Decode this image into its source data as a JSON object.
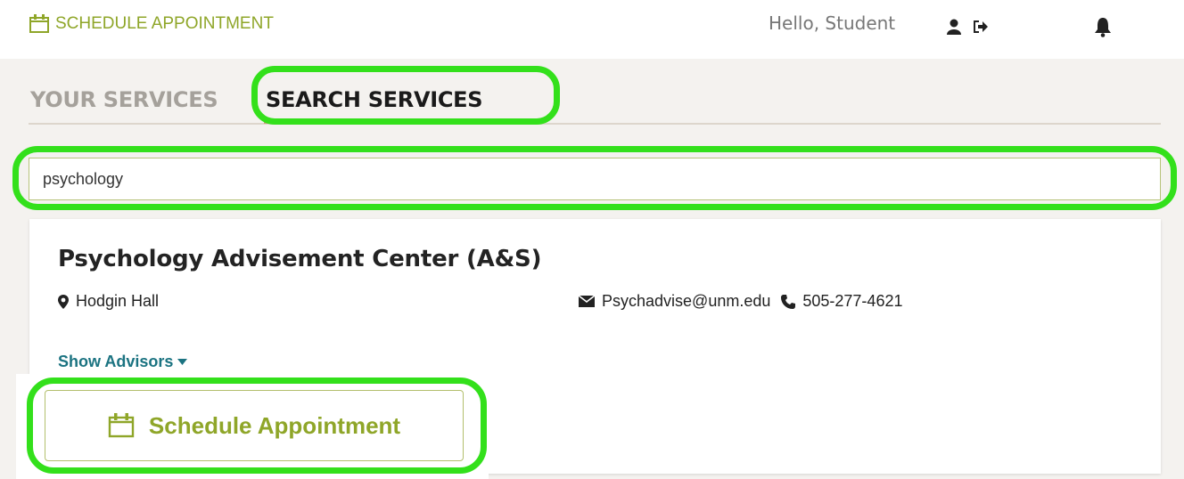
{
  "header": {
    "brand_label": "SCHEDULE APPOINTMENT",
    "greeting": "Hello, Student",
    "icons": [
      "calendar-icon",
      "user-icon",
      "sign-out-icon",
      "bell-icon"
    ]
  },
  "tabs": [
    {
      "label": "YOUR SERVICES",
      "active": false
    },
    {
      "label": "SEARCH SERVICES",
      "active": true
    }
  ],
  "search": {
    "value": "psychology"
  },
  "result": {
    "title": "Psychology Advisement Center (A&S)",
    "location": "Hodgin Hall",
    "email": "Psychadvise@unm.edu",
    "phone": "505-277-4621",
    "show_advisors_label": "Show Advisors",
    "schedule_button_label": "Schedule Appointment"
  },
  "colors": {
    "accent_green": "#8fa629",
    "highlight_green": "#33e01b",
    "link_teal": "#1b7381",
    "tab_underline": "#c9a27b"
  }
}
